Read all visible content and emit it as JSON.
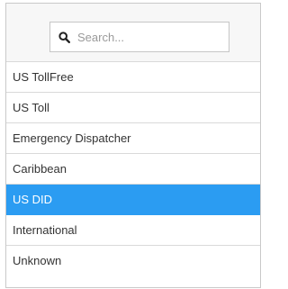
{
  "search": {
    "placeholder": "Search...",
    "icon": "search-icon"
  },
  "options": [
    {
      "label": "US TollFree",
      "selected": false
    },
    {
      "label": "US Toll",
      "selected": false
    },
    {
      "label": "Emergency Dispatcher",
      "selected": false
    },
    {
      "label": "Caribbean",
      "selected": false
    },
    {
      "label": "US DID",
      "selected": true
    },
    {
      "label": "International",
      "selected": false
    },
    {
      "label": "Unknown",
      "selected": false
    }
  ],
  "colors": {
    "selected_background": "#2b9cf2",
    "selected_text": "#ffffff"
  }
}
